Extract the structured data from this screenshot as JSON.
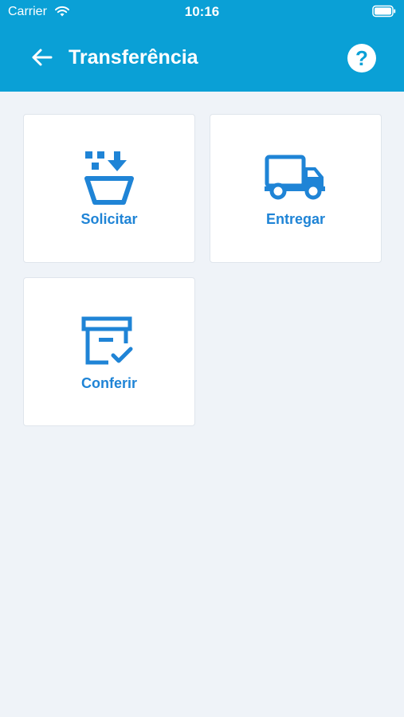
{
  "status_bar": {
    "carrier": "Carrier",
    "time": "10:16"
  },
  "header": {
    "title": "Transferência",
    "help_label": "?"
  },
  "tiles": [
    {
      "label": "Solicitar",
      "icon": "basket-download-icon"
    },
    {
      "label": "Entregar",
      "icon": "delivery-truck-icon"
    },
    {
      "label": "Conferir",
      "icon": "archive-check-icon"
    }
  ],
  "colors": {
    "header_bg": "#0aa0d6",
    "accent": "#1f84d6",
    "page_bg": "#eff3f8"
  }
}
